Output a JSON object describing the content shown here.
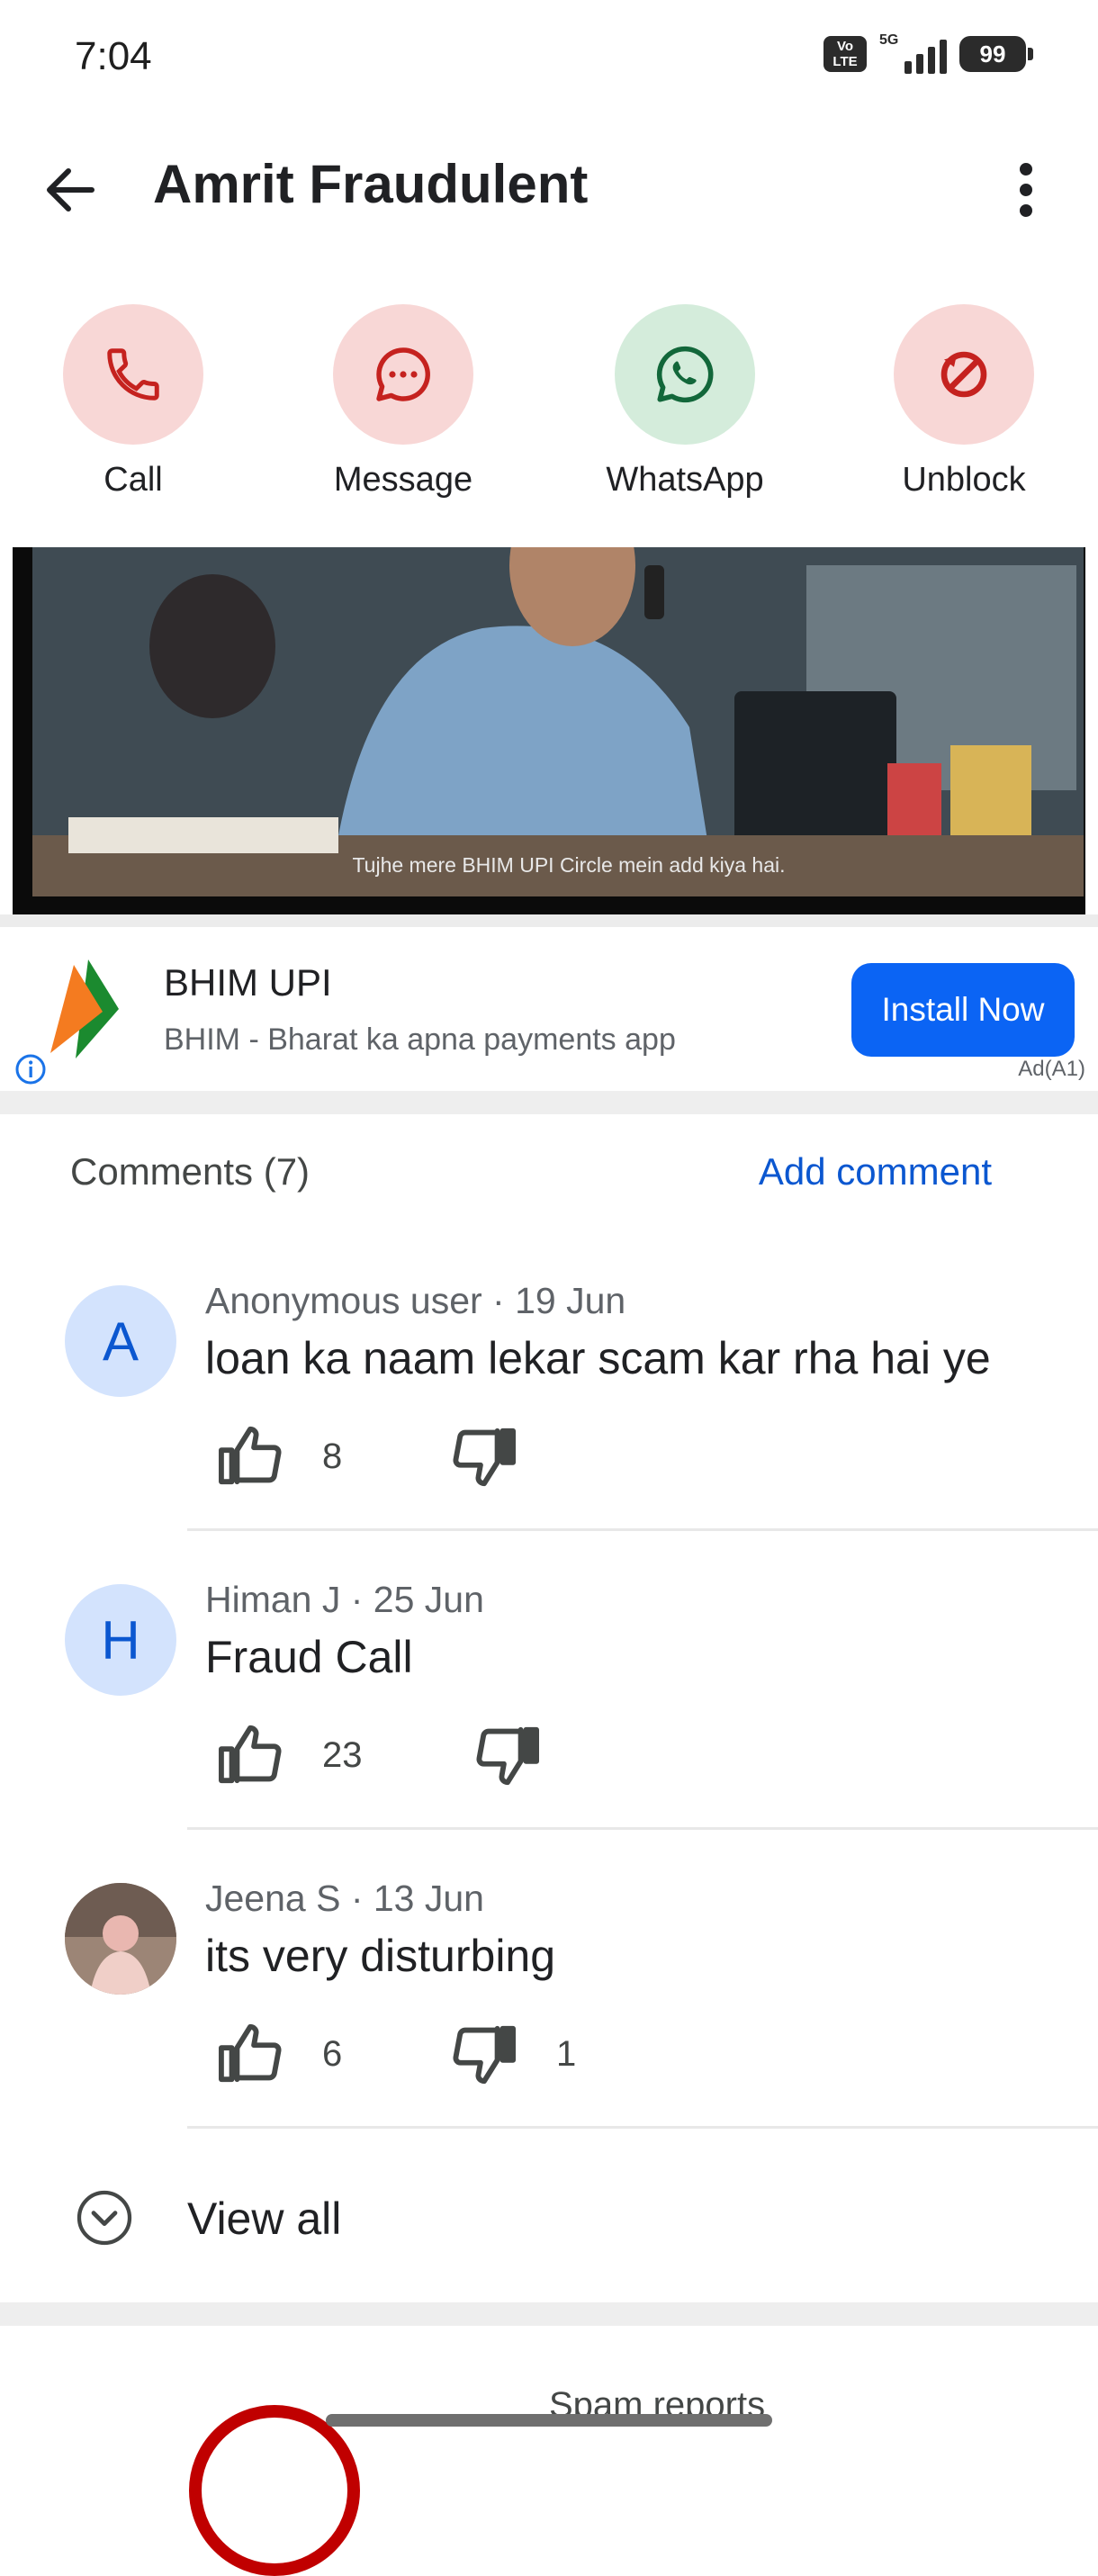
{
  "status_bar": {
    "time": "7:04",
    "volte_top": "Vo",
    "volte_bottom": "LTE",
    "network": "5G",
    "battery": "99"
  },
  "header": {
    "title": "Amrit Fraudulent"
  },
  "actions": [
    {
      "label": "Call",
      "icon": "phone-icon",
      "bg": "#f8d7d6",
      "color": "#c5221f"
    },
    {
      "label": "Message",
      "icon": "message-icon",
      "bg": "#f8d7d6",
      "color": "#c5221f"
    },
    {
      "label": "WhatsApp",
      "icon": "whatsapp-icon",
      "bg": "#d4ecdb",
      "color": "#12673a"
    },
    {
      "label": "Unblock",
      "icon": "unblock-icon",
      "bg": "#f8d7d6",
      "color": "#c5221f"
    }
  ],
  "ad": {
    "caption": "Tujhe mere BHIM UPI Circle mein add kiya hai.",
    "title": "BHIM UPI",
    "subtitle": "BHIM - Bharat ka apna payments app",
    "cta": "Install Now",
    "tag": "Ad(A1)",
    "cta_color": "#0b64f4"
  },
  "comments": {
    "header": "Comments (7)",
    "add_label": "Add comment",
    "items": [
      {
        "initial": "A",
        "meta": "Anonymous user · 19 Jun",
        "text": "loan ka naam lekar scam kar rha hai ye",
        "likes": "8",
        "dislikes": ""
      },
      {
        "initial": "H",
        "meta": "Himan J · 25 Jun",
        "text": "Fraud Call",
        "likes": "23",
        "dislikes": ""
      },
      {
        "initial": "",
        "meta": "Jeena S · 13 Jun",
        "text": "its very disturbing",
        "likes": "6",
        "dislikes": "1"
      }
    ],
    "view_all": "View all"
  },
  "spam": {
    "label": "Spam reports"
  }
}
